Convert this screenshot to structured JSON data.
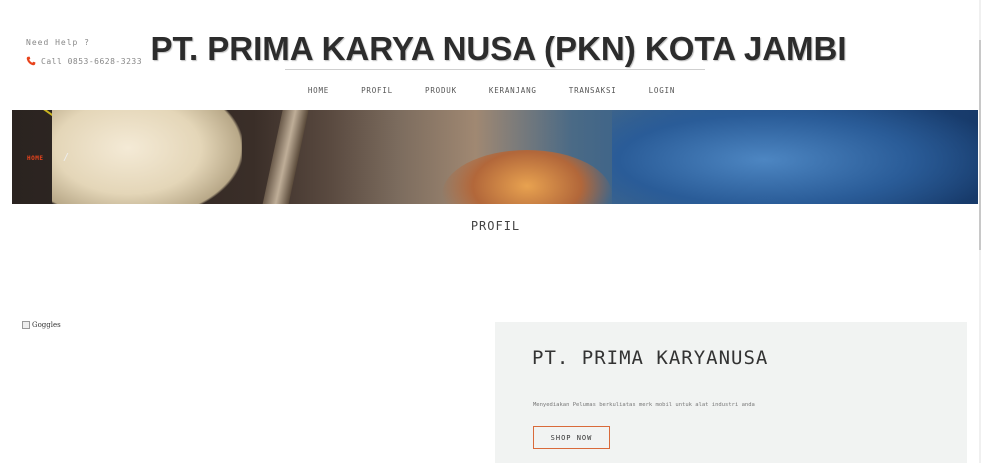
{
  "header": {
    "help_title": "Need Help ?",
    "phone": "Call 0853-6628-3233",
    "phone_icon": "phone-icon",
    "accent_color": "#e8431c",
    "site_title": "PT. PRIMA KARYA NUSA (PKN) KOTA JAMBI"
  },
  "nav": {
    "items": [
      {
        "label": "HOME"
      },
      {
        "label": "PROFIL"
      },
      {
        "label": "PRODUK"
      },
      {
        "label": "KERANJANG"
      },
      {
        "label": "TRANSAKSI"
      },
      {
        "label": "LOGIN"
      }
    ]
  },
  "hero": {
    "breadcrumb": "HOME",
    "separator": "/"
  },
  "main": {
    "heading": "PROFIL",
    "image_alt": "Goggles"
  },
  "promo": {
    "title": "PT. PRIMA KARYANUSA",
    "description": "Menyediakan Pelumas berkuliatas merk mobil untuk alat industri anda",
    "button_label": "SHOP NOW",
    "button_border_color": "#d96a3a",
    "background_color": "#f1f3f2"
  }
}
